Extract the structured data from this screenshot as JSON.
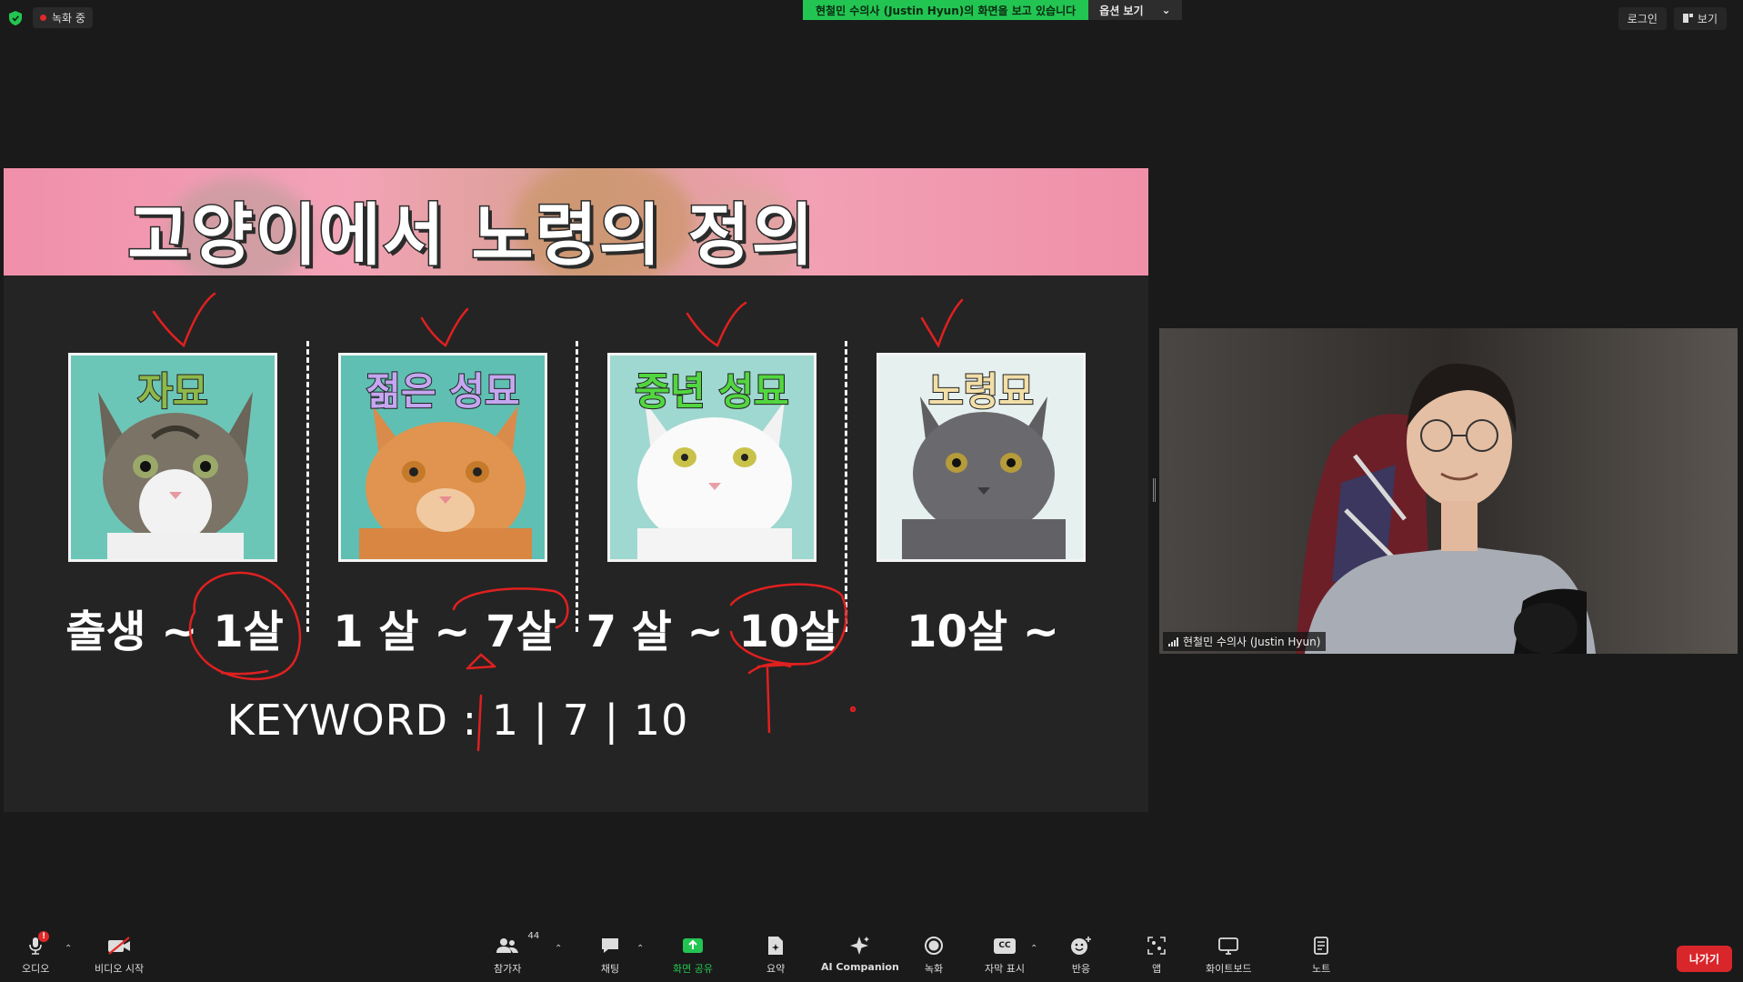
{
  "top_bar": {
    "recording_label": "녹화 중",
    "share_banner": "현철민 수의사 (Justin  Hyun)의 화면을 보고 있습니다",
    "view_options": "옵션 보기",
    "login": "로그인",
    "view": "보기"
  },
  "slide": {
    "title": "고양이에서 노령의 정의",
    "cards": [
      {
        "label": "자묘",
        "label_color": "#8db84a",
        "bg": "#6cc6b8"
      },
      {
        "label": "젊은 성묘",
        "label_color": "#c5a6f0",
        "bg": "#5fbfb3"
      },
      {
        "label": "중년 성묘",
        "label_color": "#52d640",
        "bg": "#9fd8d0"
      },
      {
        "label": "노령묘",
        "label_color": "#f2dfa8",
        "bg": "#e6f0ef"
      }
    ],
    "ages": [
      "출생 ~ 1살",
      "1 살 ~ 7살",
      "7 살 ~ 10살",
      "10살 ~"
    ],
    "keyword": "KEYWORD : 1 | 7 | 10"
  },
  "video": {
    "participant_name": "현철민 수의사 (Justin Hyun)"
  },
  "toolbar": {
    "audio": "오디오",
    "video_start": "비디오 시작",
    "participants": "참가자",
    "participant_count": "44",
    "chat": "채팅",
    "share_screen": "화면 공유",
    "summary": "요약",
    "ai_companion": "AI Companion",
    "record": "녹화",
    "captions": "자막 표시",
    "captions_icon": "CC",
    "reactions": "반응",
    "apps": "앱",
    "whiteboard": "화이트보드",
    "notes": "노트",
    "leave": "나가기",
    "mic_alert": "!"
  },
  "colors": {
    "share_green": "#23c552",
    "leave_red": "#d9262b",
    "ink_red": "#e02020"
  }
}
